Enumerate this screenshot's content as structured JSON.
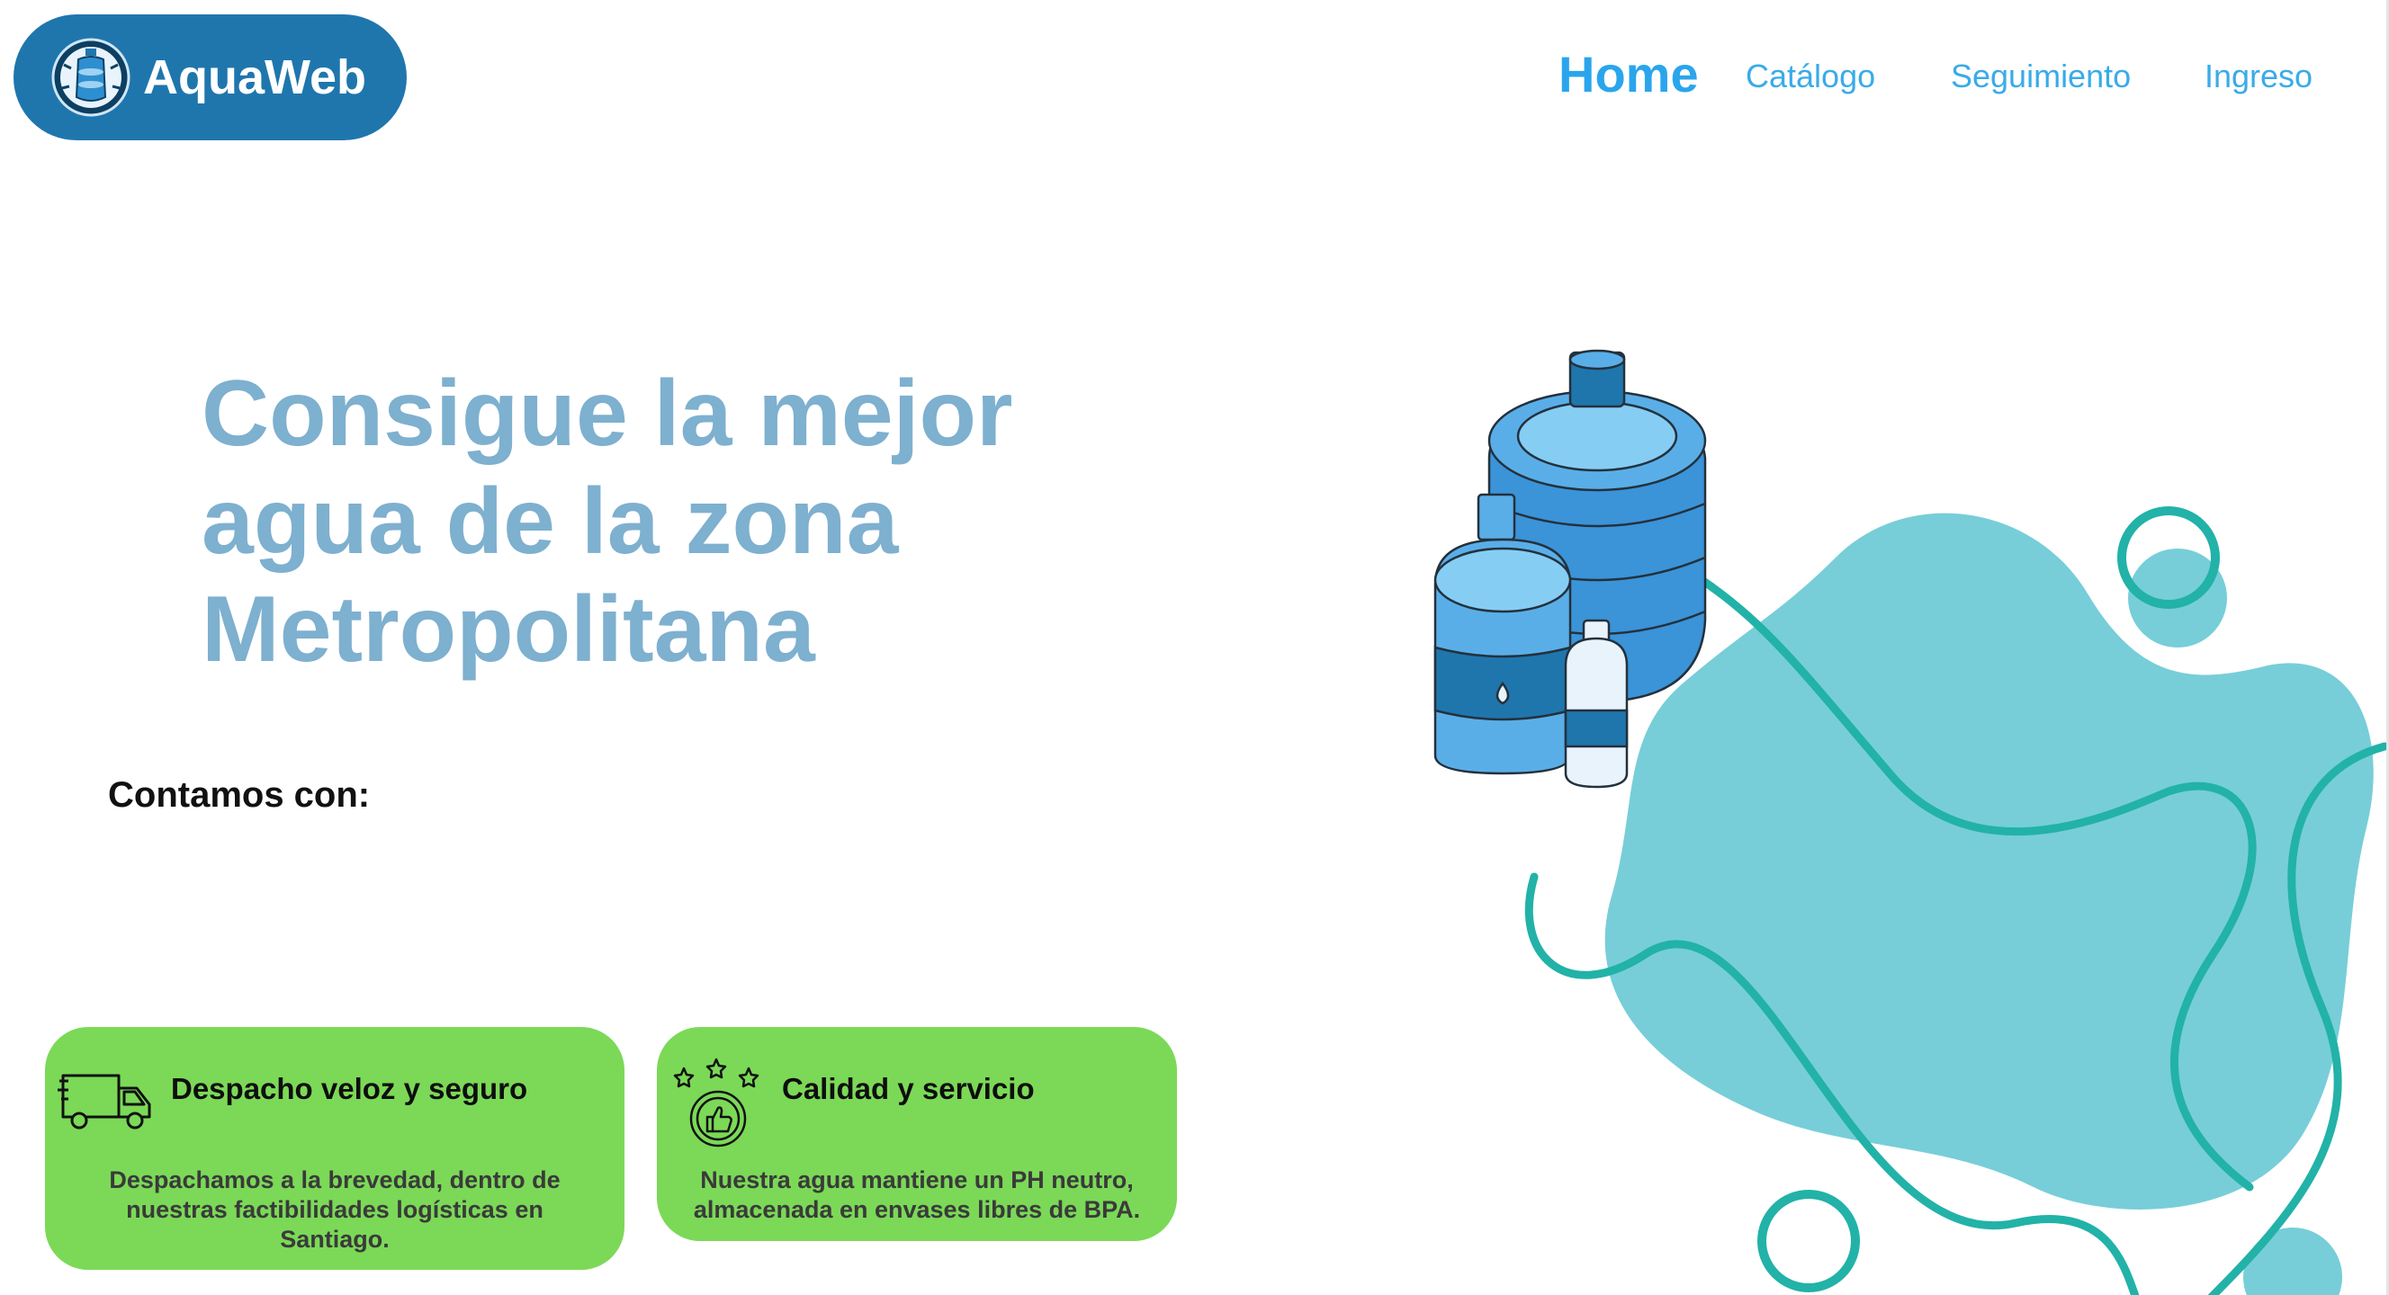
{
  "header": {
    "brand": "AquaWeb",
    "nav": {
      "home": "Home",
      "catalogo": "Catálogo",
      "seguimiento": "Seguimiento",
      "ingreso": "Ingreso"
    }
  },
  "hero": {
    "title_lines": [
      "Consigue la mejor",
      "agua de la zona",
      "Metropolitana"
    ],
    "subheading": "Contamos con:"
  },
  "features": [
    {
      "icon": "delivery-truck-icon",
      "title": "Despacho veloz y seguro",
      "description": "Despachamos a la brevedad, dentro de nuestras factibilidades logísticas en Santiago."
    },
    {
      "icon": "thumbs-up-stars-icon",
      "title": "Calidad y servicio",
      "description": "Nuestra agua mantiene un PH neutro, almacenada en envases libres de BPA."
    }
  ],
  "colors": {
    "logo_bg": "#1f76ad",
    "nav_link": "#3aabe8",
    "hero_title": "#7eb0cf",
    "card_bg": "#7bd957",
    "blob": "#77ced8",
    "swirl": "#22b2a8",
    "bottle_blue": "#5aaee8"
  },
  "illustration": {
    "icon": "water-bottles-illustration"
  }
}
